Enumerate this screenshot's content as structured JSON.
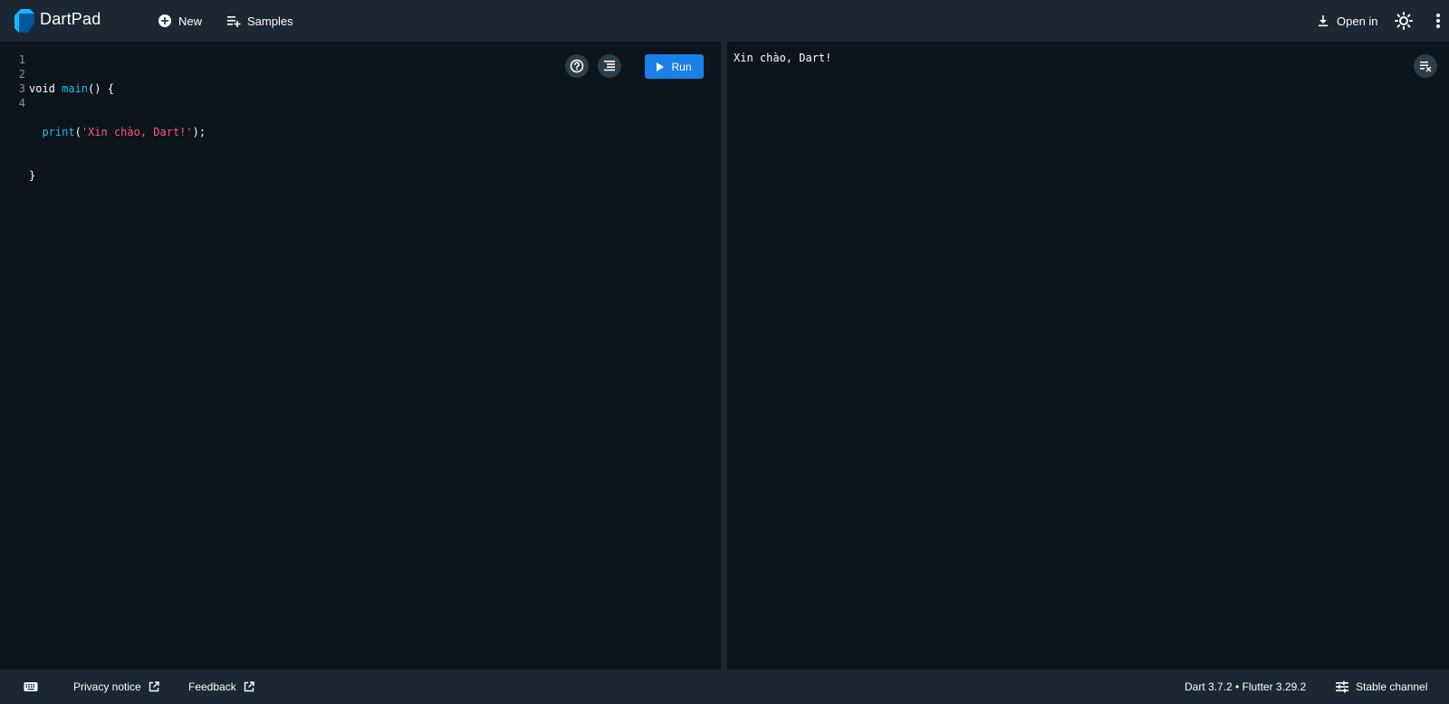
{
  "header": {
    "title": "DartPad",
    "new_label": "New",
    "samples_label": "Samples",
    "open_in_label": "Open in"
  },
  "editor": {
    "line_numbers": [
      "1",
      "2",
      "3",
      "4"
    ],
    "code": {
      "l1_kw": "void ",
      "l1_fn": "main",
      "l1_rest": "() {",
      "l2_indent": "  ",
      "l2_fn": "print",
      "l2_open": "(",
      "l2_str": "'Xin chào, Dart!'",
      "l2_close": ");",
      "l3": "}"
    },
    "run_label": "Run"
  },
  "console": {
    "output": "Xin chào, Dart!"
  },
  "footer": {
    "privacy_label": "Privacy notice",
    "feedback_label": "Feedback",
    "version_label": "Dart 3.7.2 • Flutter 3.29.2",
    "channel_label": "Stable channel"
  },
  "colors": {
    "accent": "#1a7fe8",
    "function_token": "#1fbfe9",
    "string_token": "#ff5a74",
    "bar_background": "#1b2833",
    "pane_background": "#0c141c"
  },
  "icons": [
    "dart-logo",
    "add-circle-icon",
    "playlist-add-icon",
    "download-icon",
    "brightness-icon",
    "more-vert-icon",
    "help-icon",
    "format-icon",
    "play-icon",
    "clear-console-icon",
    "keyboard-icon",
    "external-link-icon",
    "tune-icon"
  ]
}
